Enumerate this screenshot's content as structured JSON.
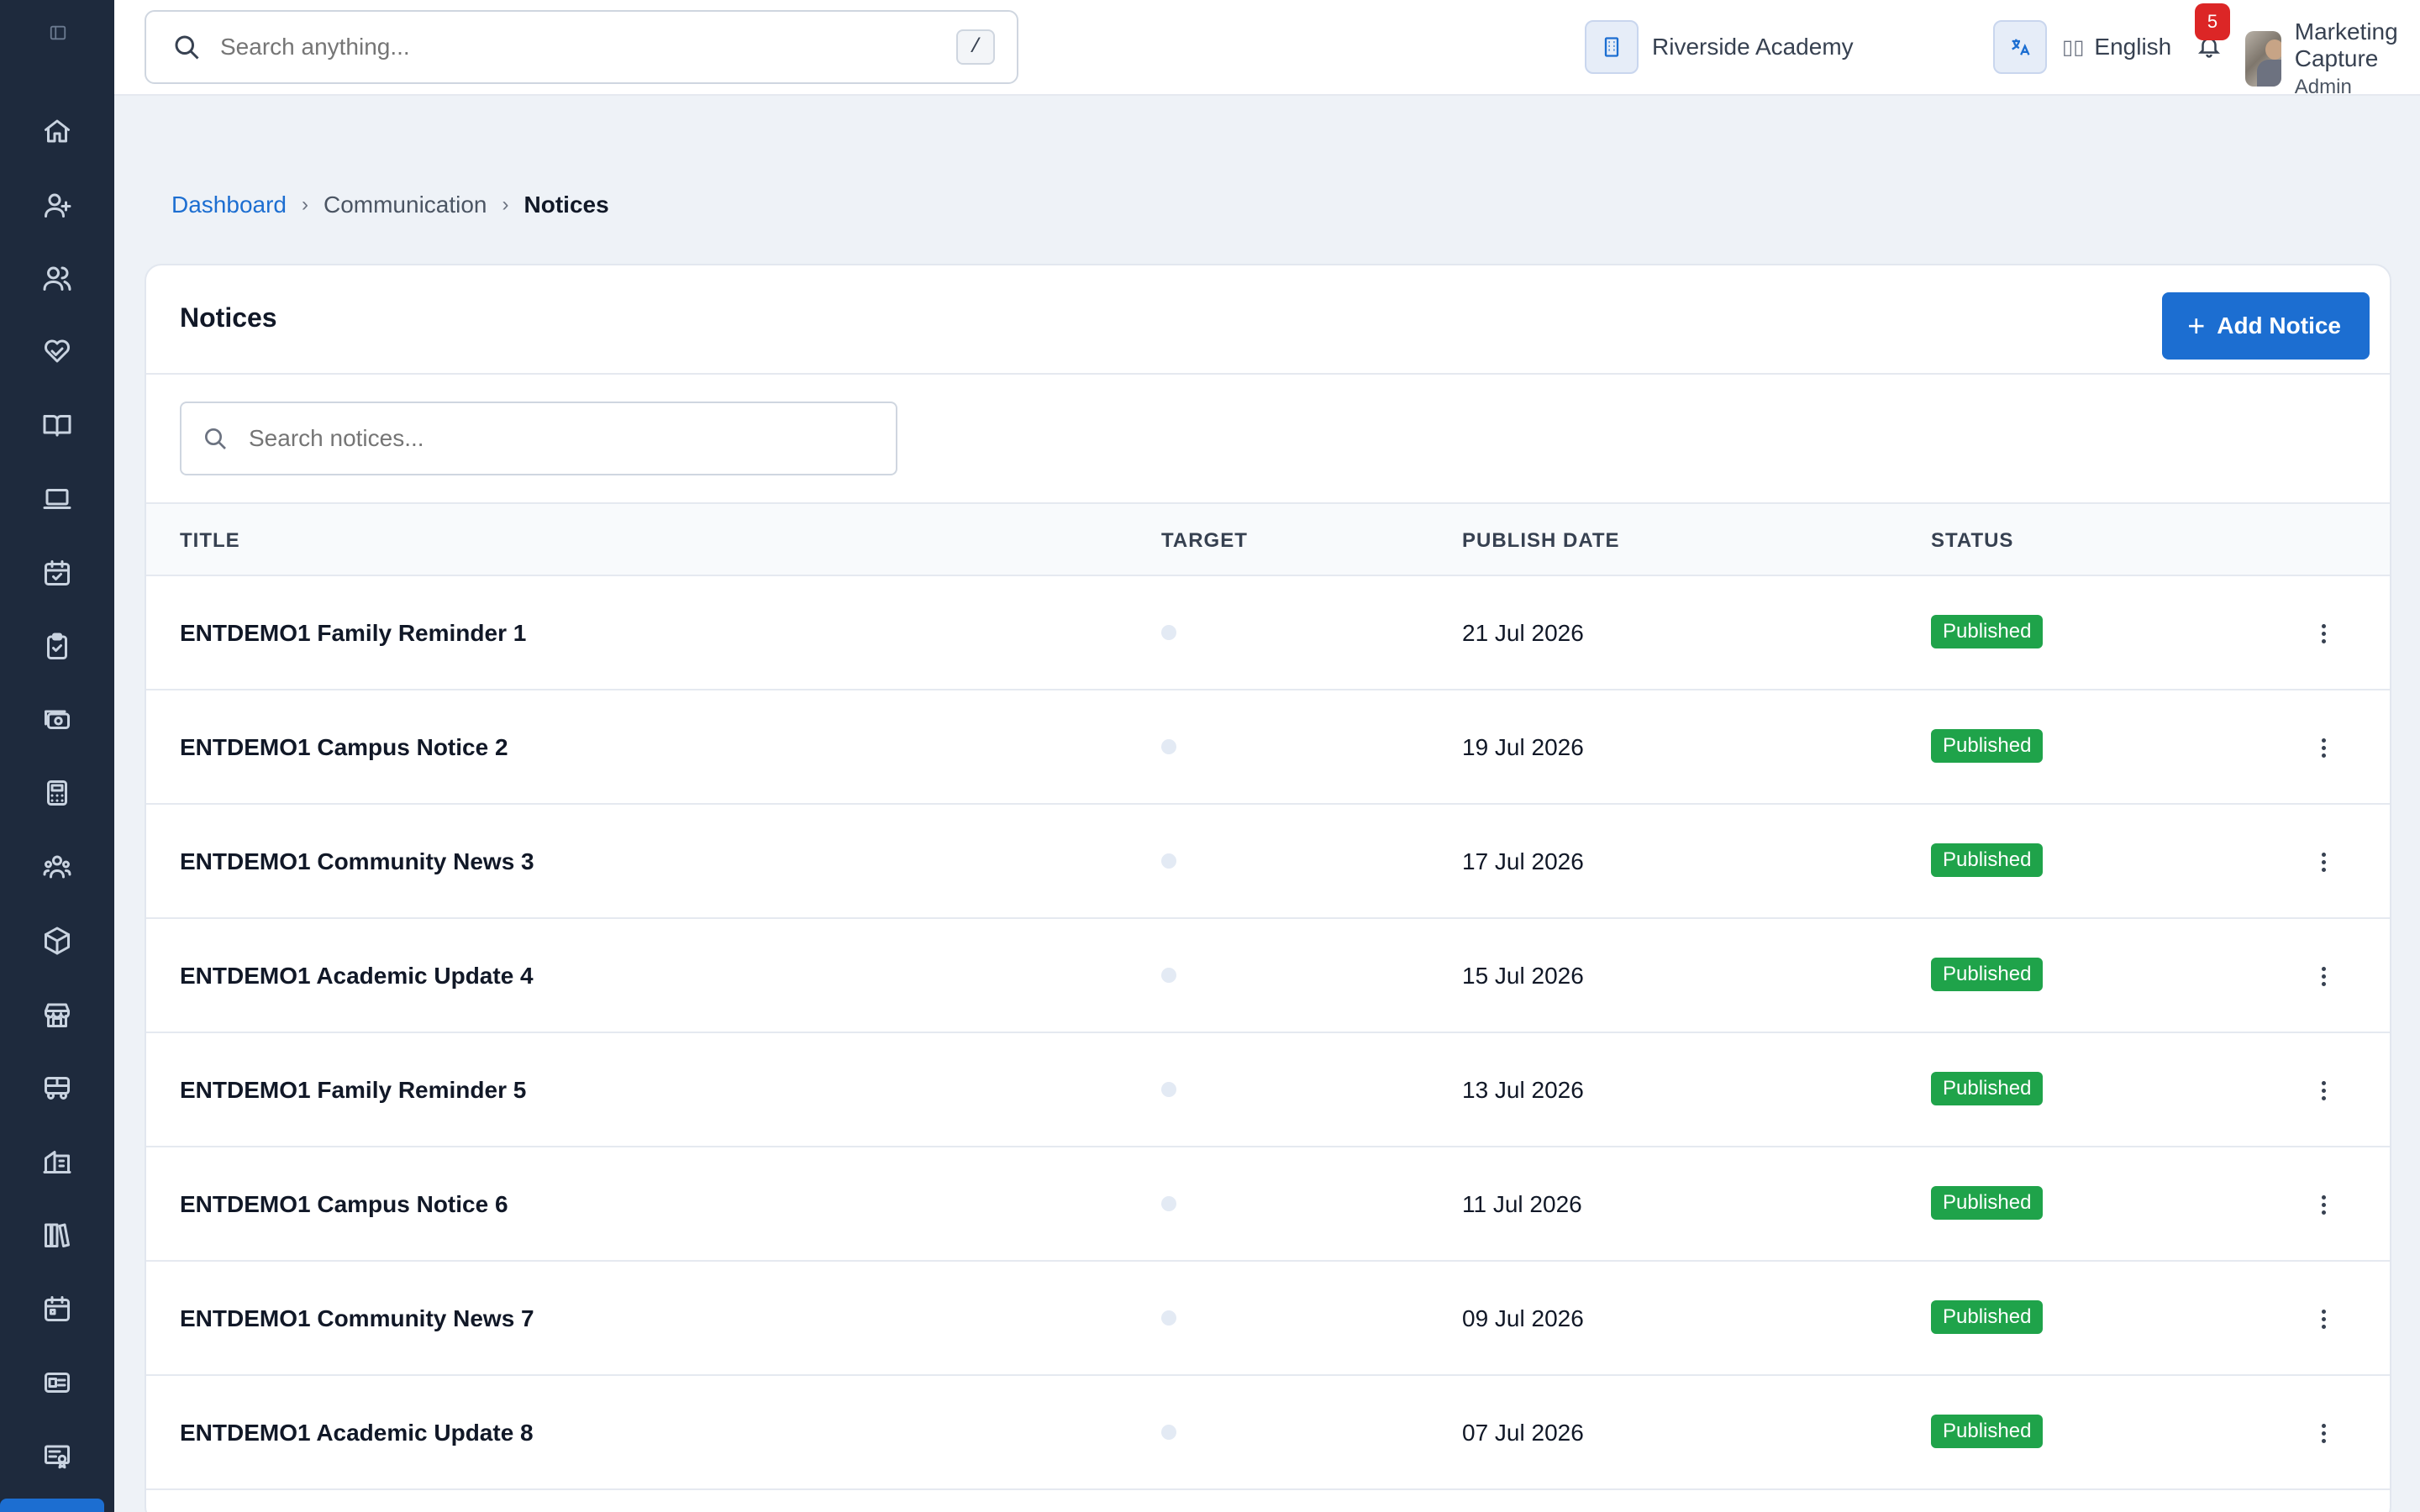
{
  "search": {
    "placeholder": "Search anything...",
    "shortcut": "/"
  },
  "header": {
    "school": "Riverside Academy",
    "language": "English",
    "notification_count": "5",
    "user_name": "Marketing Capture",
    "user_role": "Admin"
  },
  "sidebar_icons": [
    "home-icon",
    "user-plus-icon",
    "users-icon",
    "handshake-heart-icon",
    "book-open-icon",
    "laptop-icon",
    "calendar-check-icon",
    "clipboard-check-icon",
    "cash-icon",
    "calculator-icon",
    "people-group-icon",
    "package-icon",
    "store-icon",
    "bus-icon",
    "building-icon",
    "library-icon",
    "calendar-icon",
    "id-card-icon",
    "certificate-icon"
  ],
  "breadcrumb": {
    "home": "Dashboard",
    "section": "Communication",
    "current": "Notices"
  },
  "card": {
    "title": "Notices",
    "add_button": "Add Notice",
    "search_placeholder": "Search notices..."
  },
  "table": {
    "columns": {
      "title": "TITLE",
      "target": "TARGET",
      "publish_date": "PUBLISH DATE",
      "status": "STATUS"
    },
    "rows": [
      {
        "title": "ENTDEMO1 Family Reminder 1",
        "date": "21 Jul 2026",
        "status": "Published"
      },
      {
        "title": "ENTDEMO1 Campus Notice 2",
        "date": "19 Jul 2026",
        "status": "Published"
      },
      {
        "title": "ENTDEMO1 Community News 3",
        "date": "17 Jul 2026",
        "status": "Published"
      },
      {
        "title": "ENTDEMO1 Academic Update 4",
        "date": "15 Jul 2026",
        "status": "Published"
      },
      {
        "title": "ENTDEMO1 Family Reminder 5",
        "date": "13 Jul 2026",
        "status": "Published"
      },
      {
        "title": "ENTDEMO1 Campus Notice 6",
        "date": "11 Jul 2026",
        "status": "Published"
      },
      {
        "title": "ENTDEMO1 Community News 7",
        "date": "09 Jul 2026",
        "status": "Published"
      },
      {
        "title": "ENTDEMO1 Academic Update 8",
        "date": "07 Jul 2026",
        "status": "Published"
      }
    ]
  },
  "colors": {
    "sidebar": "#1e2a3d",
    "accent": "#1c6ed1",
    "status_published": "#1fa34a",
    "badge": "#dc2626"
  }
}
